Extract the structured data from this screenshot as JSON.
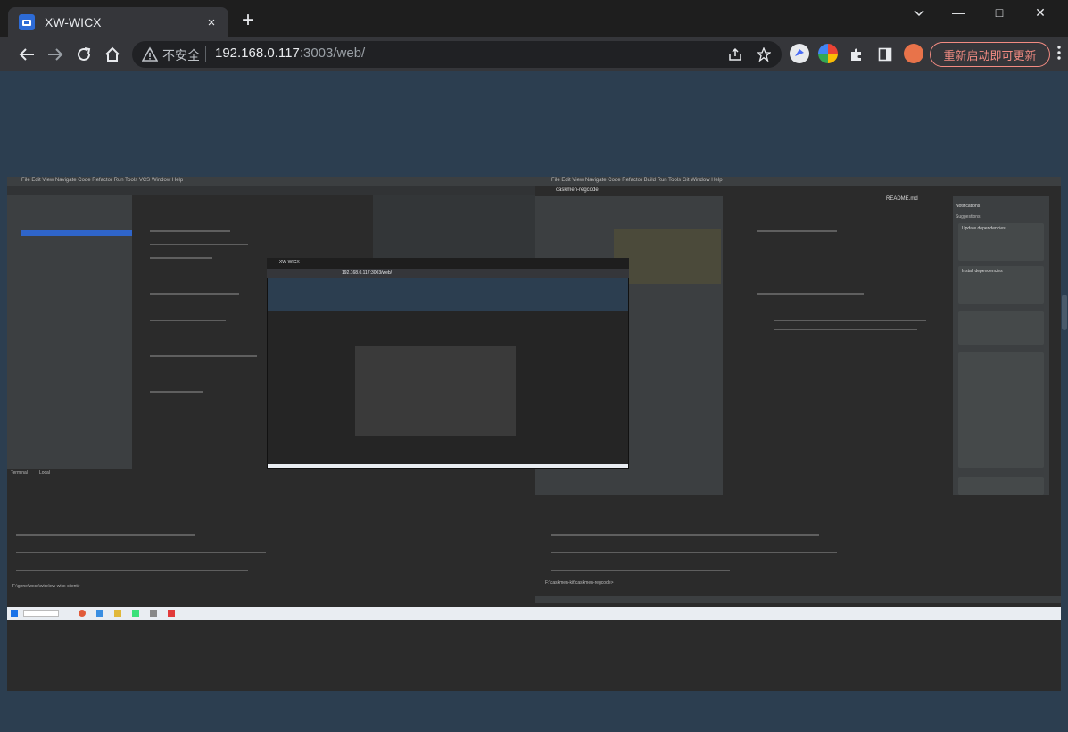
{
  "browser": {
    "tab_title": "XW-WICX",
    "tab_close": "×",
    "new_tab": "+",
    "insecure_label": "不安全",
    "url_host": "192.168.0.117",
    "url_rest": ":3003/web/",
    "update_button": "重新启动即可更新",
    "window_controls": {
      "minimize": "—",
      "restore": "□",
      "close": "✕"
    },
    "icons": [
      "back-icon",
      "forward-icon",
      "reload-icon",
      "home-icon",
      "warning-icon",
      "share-icon",
      "star-icon",
      "puzzle-icon",
      "sidebar-icon",
      "kebab-icon"
    ]
  },
  "remote_screen": {
    "left_ide": {
      "menu": "File Edit View Navigate Code Refactor Run Tools VCS Window Help",
      "terminal_label": "Terminal",
      "terminal_tab": "Local",
      "terminal_prompt": "F:\\gene\\wxcx\\wicx\\xw-wicx-client>"
    },
    "right_ide": {
      "menu": "File Edit View Navigate Code Refactor Build Run Tools Git Window Help",
      "project": "caskmen-regcode",
      "file_tab": "README.md",
      "notifications_title": "Notifications",
      "suggestions": "Suggestions",
      "update_deps": "Update dependencies",
      "install_deps": "Install dependencies",
      "terminal_prompt": "F:\\caskmen-kit\\caskmen-regcode>"
    },
    "nested_browser_title": "XW-WICX",
    "nested_url": "192.168.0.117:3003/web/"
  }
}
